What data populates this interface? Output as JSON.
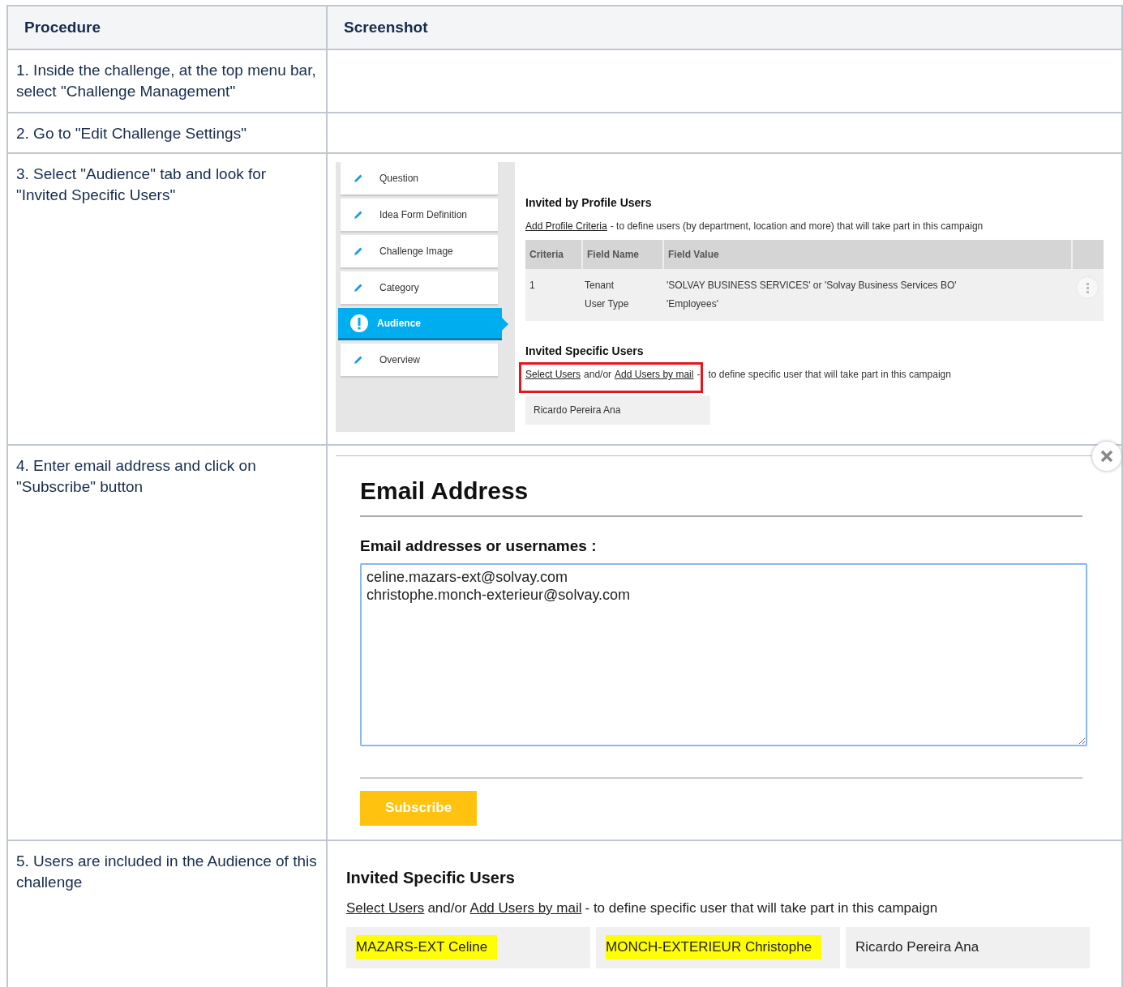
{
  "table": {
    "columns": [
      "Procedure",
      "Screenshot"
    ],
    "rows": [
      {
        "step": "1. Inside the challenge, at the top menu bar, select \"Challenge Management\"",
        "screenshot": {
          "kind": "none"
        }
      },
      {
        "step": "2. Go to \"Edit Challenge Settings\"",
        "screenshot": {
          "kind": "none"
        }
      },
      {
        "step": "3. Select \"Audience\" tab and look for \"Invited Specific Users\"",
        "screenshot": {
          "kind": "audience",
          "menu": [
            {
              "label": "Question",
              "selected": false
            },
            {
              "label": "Idea Form Definition",
              "selected": false
            },
            {
              "label": "Challenge Image",
              "selected": false
            },
            {
              "label": "Category",
              "selected": false
            },
            {
              "label": "Audience",
              "selected": true
            },
            {
              "label": "Overview",
              "selected": false
            }
          ],
          "profile_title": "Invited by Profile Users",
          "profile_line": {
            "parts": [
              {
                "kind": "link",
                "text": "Add Profile Criteria"
              },
              {
                "kind": "text",
                "text": "- to define users (by department, location and more) that will take part in this campaign"
              }
            ]
          },
          "criteria_columns": [
            "Criteria",
            "Field Name",
            "Field Value"
          ],
          "criteria_rows": [
            {
              "criteria": "1",
              "field_names": [
                "Tenant",
                "User Type"
              ],
              "field_values": [
                "'SOLVAY BUSINESS SERVICES' or 'Solvay Business Services BO'",
                "'Employees'"
              ]
            }
          ],
          "specific_title": "Invited Specific Users",
          "specific_line": {
            "framed_parts": [
              {
                "kind": "link",
                "text": "Select Users"
              },
              {
                "kind": "text",
                "text": "and/or"
              },
              {
                "kind": "link",
                "text": "Add Users by mail"
              },
              {
                "kind": "text",
                "text": "-"
              }
            ],
            "parts": [
              {
                "kind": "text",
                "text": "to define specific user that will take part in this campaign"
              }
            ]
          },
          "users": [
            {
              "name": "Ricardo Pereira Ana",
              "highlighted": false
            }
          ]
        }
      },
      {
        "step": "4. Enter email address and click on \"Subscribe\" button",
        "screenshot": {
          "kind": "email_dialog",
          "title": "Email Address",
          "field_label": "Email addresses or usernames :",
          "value": "celine.mazars-ext@solvay.com\nchristophe.monch-exterieur@solvay.com",
          "button": "Subscribe"
        }
      },
      {
        "step": "5. Users are included in the Audience of this challenge",
        "screenshot": {
          "kind": "invited_users",
          "title": "Invited Specific Users",
          "line": {
            "parts": [
              {
                "kind": "link",
                "text": "Select Users"
              },
              {
                "kind": "text",
                "text": "and/or"
              },
              {
                "kind": "link",
                "text": "Add Users by mail"
              },
              {
                "kind": "text",
                "text": "- to define specific user that will take part in this campaign"
              }
            ]
          },
          "users": [
            {
              "name": "MAZARS-EXT Celine",
              "highlighted": true
            },
            {
              "name": "MONCH-EXTERIEUR Christophe",
              "highlighted": true
            },
            {
              "name": "Ricardo Pereira Ana",
              "highlighted": false
            }
          ]
        }
      }
    ]
  }
}
